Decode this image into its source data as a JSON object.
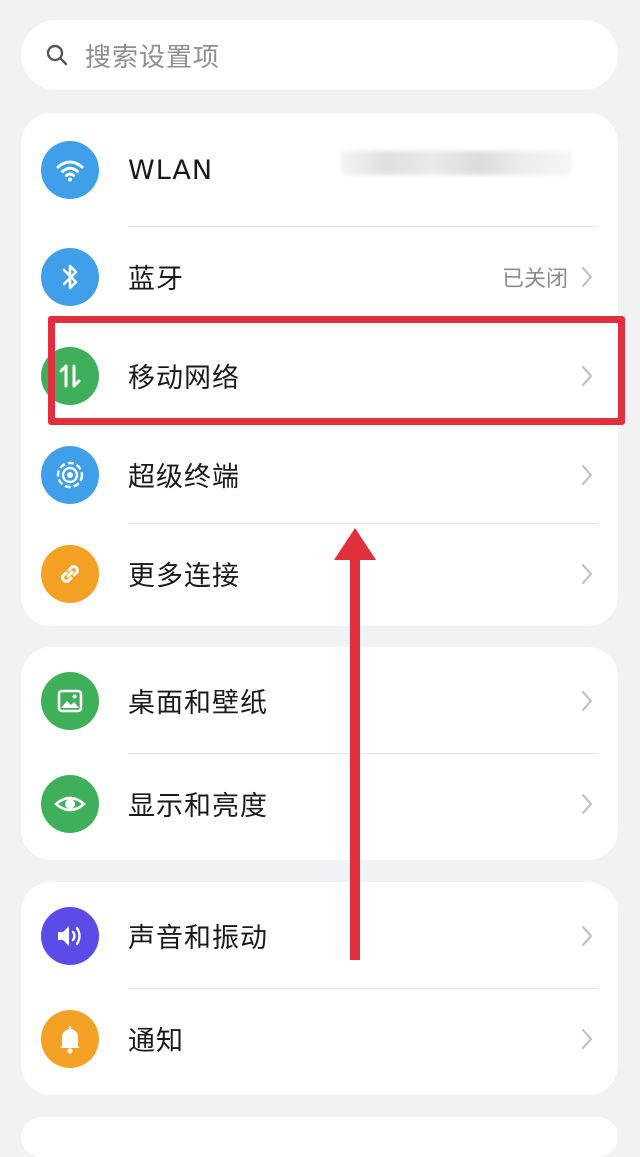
{
  "search": {
    "placeholder": "搜索设置项"
  },
  "connectivity": [
    {
      "label": "WLAN",
      "value": "",
      "icon": "wifi-icon",
      "color": "#3f9fe8"
    },
    {
      "label": "蓝牙",
      "value": "已关闭",
      "icon": "bluetooth-icon",
      "color": "#3f9fe8"
    },
    {
      "label": "移动网络",
      "value": "",
      "icon": "mobile-data-icon",
      "color": "#3fb05a"
    },
    {
      "label": "超级终端",
      "value": "",
      "icon": "super-device-icon",
      "color": "#3f9fe8"
    },
    {
      "label": "更多连接",
      "value": "",
      "icon": "link-icon",
      "color": "#f5a125"
    }
  ],
  "display": [
    {
      "label": "桌面和壁纸",
      "icon": "wallpaper-icon",
      "color": "#3fb05a"
    },
    {
      "label": "显示和亮度",
      "icon": "eye-icon",
      "color": "#3fb05a"
    }
  ],
  "sound": [
    {
      "label": "声音和振动",
      "icon": "speaker-icon",
      "color": "#5b4ce8"
    },
    {
      "label": "通知",
      "icon": "bell-icon",
      "color": "#f5a125"
    }
  ],
  "annotation_color": "#e0303c"
}
